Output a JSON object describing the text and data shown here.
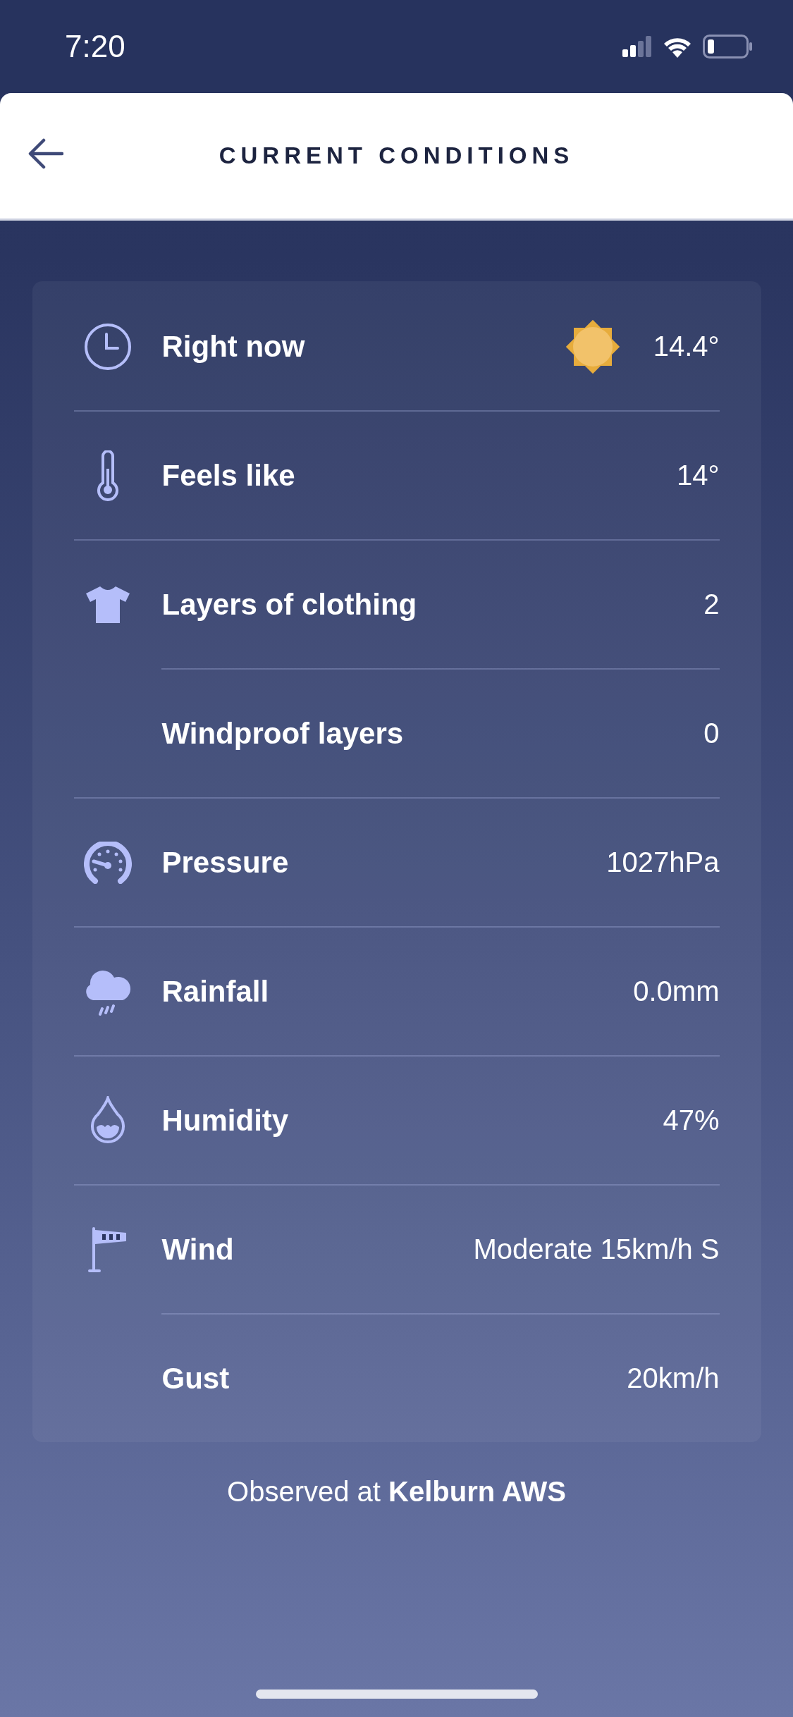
{
  "status_bar": {
    "time": "7:20"
  },
  "header": {
    "title": "CURRENT CONDITIONS"
  },
  "rows": [
    {
      "kind": "main",
      "label": "Right now",
      "value": "14.4°"
    },
    {
      "kind": "main",
      "label": "Feels like",
      "value": "14°"
    },
    {
      "kind": "main",
      "label": "Layers of clothing",
      "value": "2"
    },
    {
      "kind": "sub",
      "label": "Windproof layers",
      "value": "0"
    },
    {
      "kind": "main",
      "label": "Pressure",
      "value": "1027hPa"
    },
    {
      "kind": "main",
      "label": "Rainfall",
      "value": "0.0mm"
    },
    {
      "kind": "main",
      "label": "Humidity",
      "value": "47%"
    },
    {
      "kind": "main",
      "label": "Wind",
      "value": "Moderate 15km/h S"
    },
    {
      "kind": "sub",
      "label": "Gust",
      "value": "20km/h"
    }
  ],
  "footer": "Observed at **Kelburn AWS**"
}
